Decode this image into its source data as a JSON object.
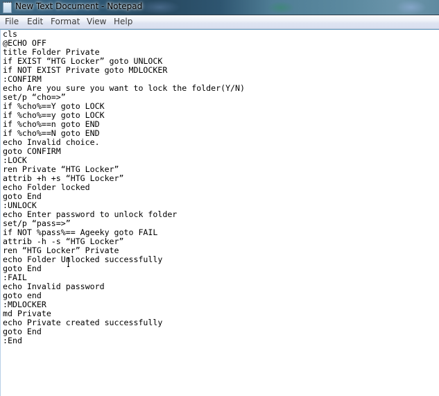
{
  "window": {
    "title": "New Text Document - Notepad",
    "icon": "notepad-icon"
  },
  "menu": [
    {
      "label": "File"
    },
    {
      "label": "Edit"
    },
    {
      "label": "Format"
    },
    {
      "label": "View"
    },
    {
      "label": "Help"
    }
  ],
  "editor": {
    "lines": [
      "cls",
      "@ECHO OFF",
      "title Folder Private",
      "if EXIST “HTG Locker” goto UNLOCK",
      "if NOT EXIST Private goto MDLOCKER",
      ":CONFIRM",
      "echo Are you sure you want to lock the folder(Y/N)",
      "set/p “cho=>”",
      "if %cho%==Y goto LOCK",
      "if %cho%==y goto LOCK",
      "if %cho%==n goto END",
      "if %cho%==N goto END",
      "echo Invalid choice.",
      "goto CONFIRM",
      ":LOCK",
      "ren Private “HTG Locker”",
      "attrib +h +s “HTG Locker”",
      "echo Folder locked",
      "goto End",
      ":UNLOCK",
      "echo Enter password to unlock folder",
      "set/p “pass=>”",
      "if NOT %pass%== Ageeky goto FAIL",
      "attrib -h -s “HTG Locker”",
      "ren “HTG Locker” Private",
      "echo Folder Unlocked successfully",
      "goto End",
      ":FAIL",
      "echo Invalid password",
      "goto end",
      ":MDLOCKER",
      "md Private",
      "echo Private created successfully",
      "goto End",
      ":End"
    ]
  }
}
